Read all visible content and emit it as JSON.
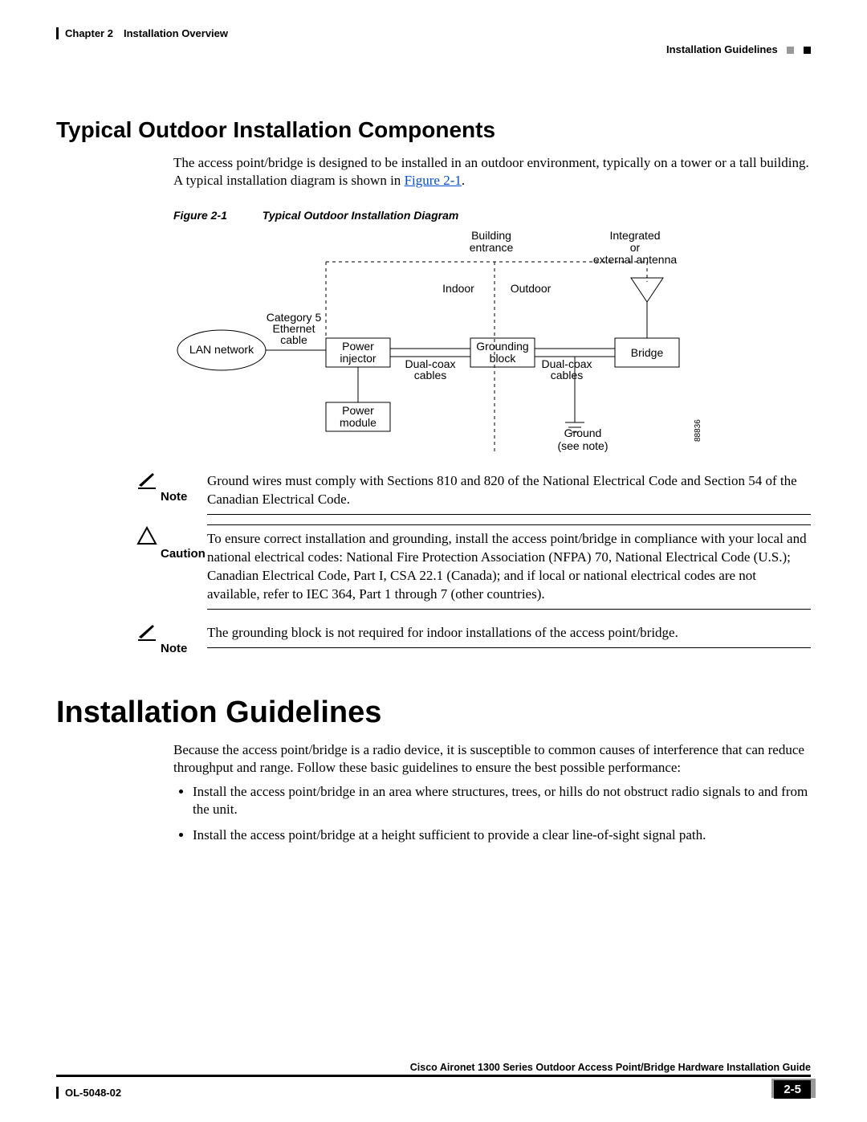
{
  "header": {
    "left": "Chapter 2 Installation Overview",
    "right": "Installation Guidelines"
  },
  "section1": {
    "title": "Typical Outdoor Installation Components",
    "para1_a": "The access point/bridge is designed to be installed in an outdoor environment, typically on a tower or a tall building. A typical installation diagram is shown in ",
    "para1_link": "Figure 2-1",
    "para1_b": "."
  },
  "figure": {
    "num": "Figure 2-1",
    "title": "Typical Outdoor Installation Diagram",
    "labels": {
      "lan": "LAN network",
      "cat5_1": "Category 5",
      "cat5_2": "Ethernet",
      "cat5_3": "cable",
      "power_inj1": "Power",
      "power_inj2": "injector",
      "power_mod1": "Power",
      "power_mod2": "module",
      "dual1": "Dual-coax",
      "dual2": "cables",
      "ground_b1": "Grounding",
      "ground_b2": "block",
      "bridge": "Bridge",
      "bld1": "Building",
      "bld2": "entrance",
      "indoor": "Indoor",
      "outdoor": "Outdoor",
      "ant1": "Integrated",
      "ant2": "or",
      "ant3": "external antenna",
      "gnd1": "Ground",
      "gnd2": "(see note)",
      "id": "88836"
    }
  },
  "notes": {
    "note1_label": "Note",
    "note1_text": "Ground wires must comply with Sections 810 and 820 of the National Electrical Code and Section 54 of the Canadian Electrical Code.",
    "caution_label": "Caution",
    "caution_text": "To ensure correct installation and grounding, install the access point/bridge in compliance with your local and national electrical codes: National Fire Protection Association (NFPA) 70, National Electrical Code (U.S.); Canadian Electrical Code, Part I, CSA 22.1 (Canada); and if local or national electrical codes are not available, refer to IEC 364, Part 1 through 7 (other countries).",
    "note2_label": "Note",
    "note2_text": "The grounding block is not required for indoor installations of the access point/bridge."
  },
  "section2": {
    "title": "Installation Guidelines",
    "para": "Because the access point/bridge is a radio device, it is susceptible to common causes of interference that can reduce throughput and range. Follow these basic guidelines to ensure the best possible performance:",
    "b1": "Install the access point/bridge in an area where structures, trees, or hills do not obstruct radio signals to and from the unit.",
    "b2": "Install the access point/bridge at a height sufficient to provide a clear line-of-sight signal path."
  },
  "footer": {
    "title": "Cisco Aironet 1300 Series Outdoor Access Point/Bridge Hardware Installation Guide",
    "doc": "OL-5048-02",
    "page": "2-5"
  }
}
